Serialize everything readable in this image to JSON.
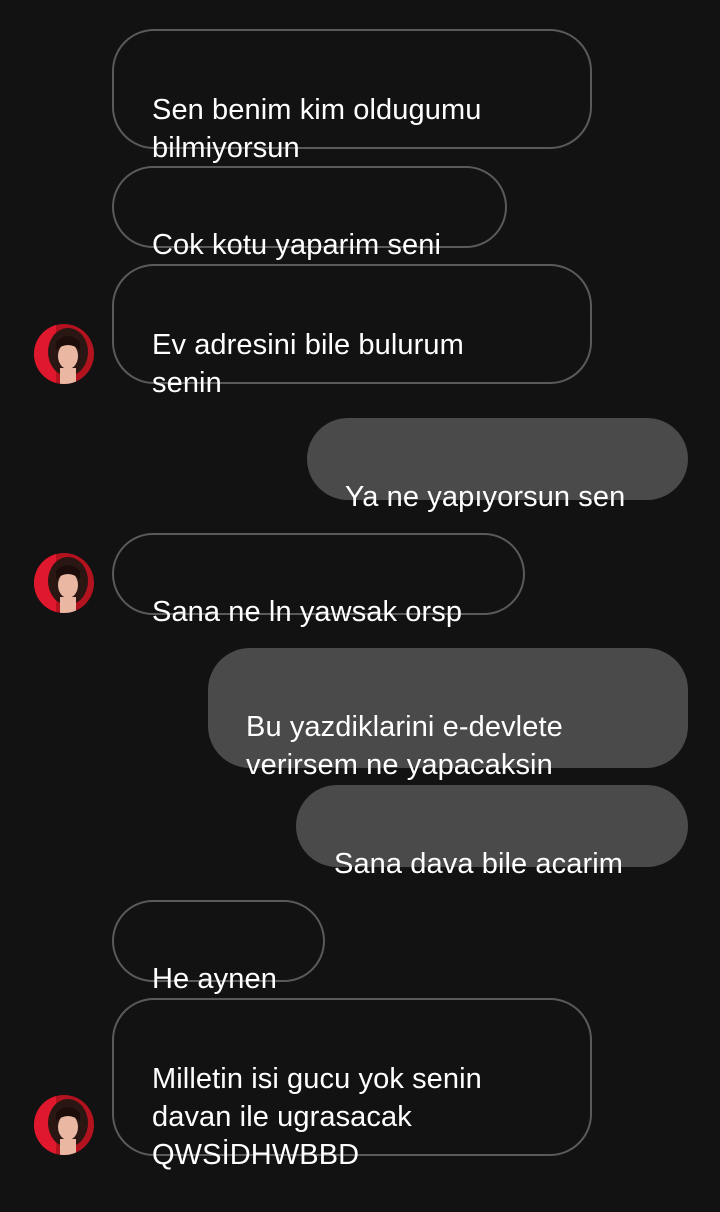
{
  "messages": [
    {
      "direction": "received",
      "text": "Sen benim kim oldugumu\nbilmiyorsun"
    },
    {
      "direction": "received",
      "text": "Cok kotu yaparim seni"
    },
    {
      "direction": "received",
      "text": "Ev adresini bile bulurum\nsenin"
    },
    {
      "direction": "sent",
      "text": "Ya ne yapıyorsun sen"
    },
    {
      "direction": "received",
      "text": "Sana ne ln yawsak orsp"
    },
    {
      "direction": "sent",
      "text": "Bu yazdiklarini e-devlete\nverirsem ne yapacaksin"
    },
    {
      "direction": "sent",
      "text": "Sana dava bile acarim"
    },
    {
      "direction": "received",
      "text": "He aynen"
    },
    {
      "direction": "received",
      "text": "Milletin isi gucu yok senin\ndavan ile ugrasacak\nQWSİDHWBBD"
    }
  ],
  "avatar": {
    "icon": "contact-avatar-icon",
    "accent": "#e0182d"
  },
  "colors": {
    "background": "#121212",
    "received_border": "#5a5a5a",
    "sent_fill": "#4a4a4a",
    "text": "#ffffff"
  }
}
